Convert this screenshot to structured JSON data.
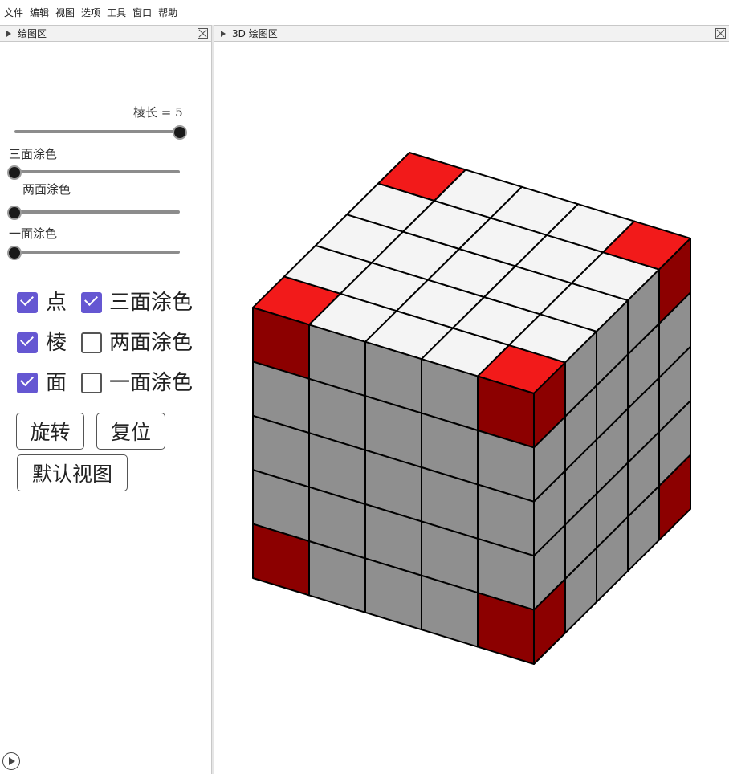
{
  "menu": [
    "文件",
    "编辑",
    "视图",
    "选项",
    "工具",
    "窗口",
    "帮助"
  ],
  "left_panel": {
    "title": "绘图区"
  },
  "right_panel": {
    "title": "3D 绘图区"
  },
  "sliders": {
    "edge": {
      "label": "棱长 = 5",
      "value": 5,
      "min": 1,
      "max": 5
    },
    "three": {
      "label": "三面涂色",
      "value": 0
    },
    "two": {
      "label": "两面涂色",
      "value": 0
    },
    "one": {
      "label": "一面涂色",
      "value": 0
    }
  },
  "checkboxes": [
    {
      "label": "点",
      "checked": true
    },
    {
      "label": "三面涂色",
      "checked": true
    },
    {
      "label": "棱",
      "checked": true
    },
    {
      "label": "两面涂色",
      "checked": false
    },
    {
      "label": "面",
      "checked": true
    },
    {
      "label": "一面涂色",
      "checked": false
    }
  ],
  "buttons": {
    "rotate": "旋转",
    "reset": "复位",
    "default_view": "默认视图"
  },
  "cube": {
    "n": 5,
    "colors": {
      "top": "#f4f4f4",
      "side": "#8f8f8f",
      "top_corner": "#f21a1a",
      "side_corner": "#8c0000",
      "edge": "#000000"
    }
  }
}
